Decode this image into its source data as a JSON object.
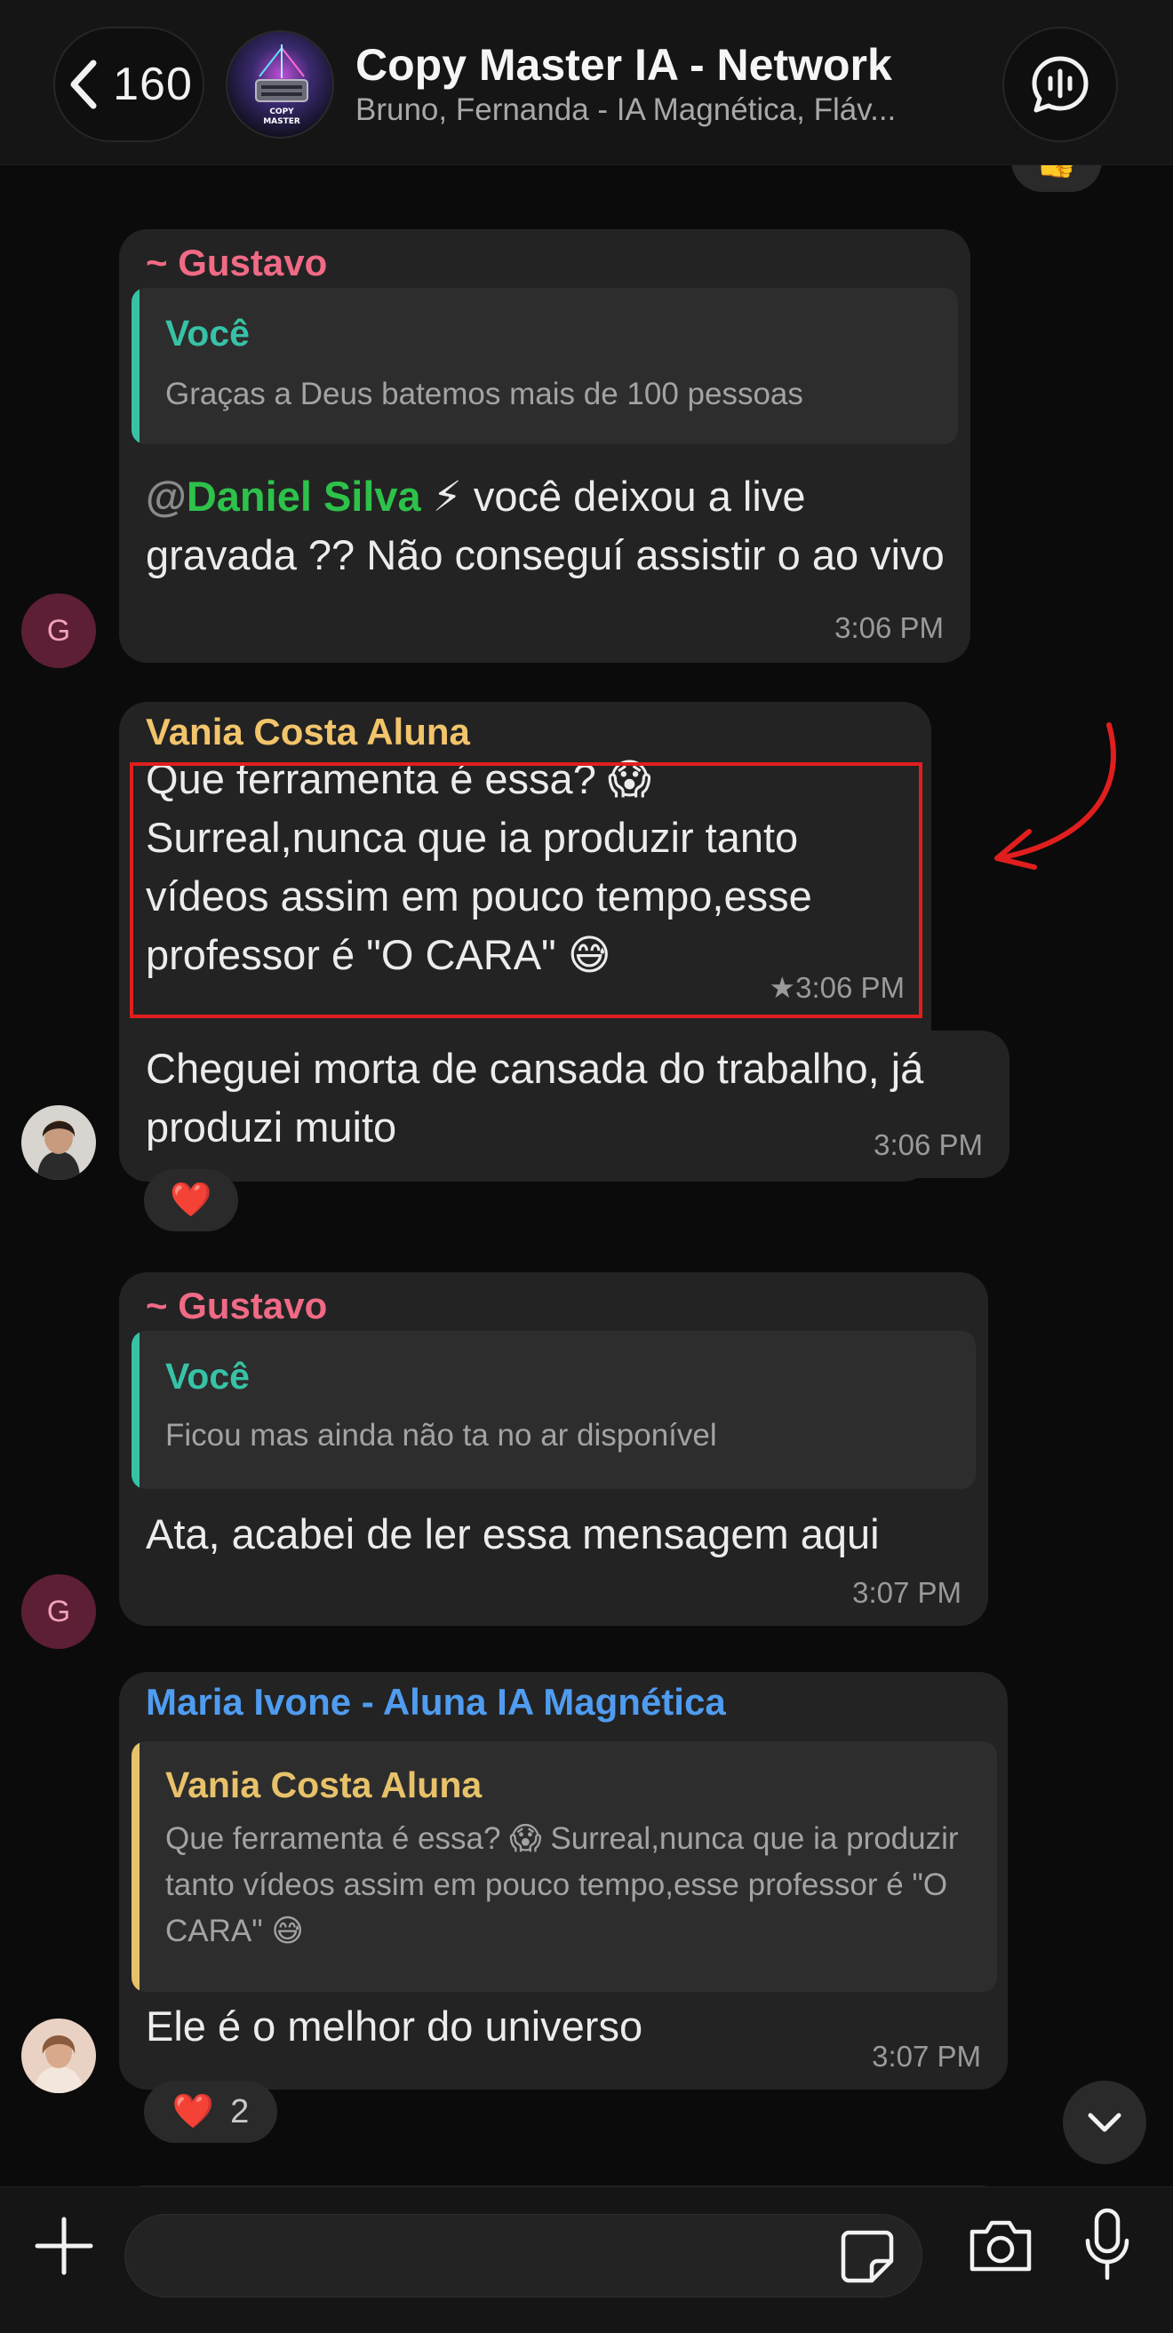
{
  "header": {
    "back_count": "160",
    "group_title": "Copy Master IA - Network",
    "group_members": "Bruno, Fernanda - IA Magnética, Fláv...",
    "group_avatar_lines": [
      "COPY",
      "MASTER"
    ]
  },
  "messages": [
    {
      "sender": "~ Gustavo",
      "sender_color": "#f06a86",
      "quote_name": "Você",
      "quote_text": "Graças a Deus batemos mais de 100 pessoas",
      "mention_at": "@",
      "mention": "Daniel Silva",
      "mention_emoji": "⚡",
      "text_after_mention": " você deixou a live gravada ?? Não conseguí assistir o ao vivo",
      "time": "3:06 PM",
      "avatar_letter": "G"
    },
    {
      "sender": "Vania Costa Aluna",
      "sender_color": "#f2c46b",
      "text": "Que ferramenta é essa? 😱 Surreal,nunca que ia produzir tanto vídeos assim em pouco tempo,esse professor é \"O CARA\" 😅",
      "star": "★",
      "time": "3:06 PM"
    },
    {
      "text": "Cheguei morta de cansada do trabalho, já produzi muito",
      "time": "3:06 PM",
      "reaction": "❤️"
    },
    {
      "sender": "~ Gustavo",
      "sender_color": "#f06a86",
      "quote_name": "Você",
      "quote_text": "Ficou mas ainda não ta no ar disponível",
      "text": "Ata, acabei de ler essa mensagem aqui",
      "time": "3:07 PM",
      "avatar_letter": "G"
    },
    {
      "sender": "Maria Ivone - Aluna IA Magnética",
      "sender_color": "#4f9cf0",
      "quote_name": "Vania Costa Aluna",
      "quote_text": "Que ferramenta é essa? 😱 Surreal,nunca que ia produzir tanto vídeos assim em pouco tempo,esse professor é \"O CARA\" 😅",
      "text": "Ele é o melhor do universo",
      "time": "3:07 PM",
      "reaction": "❤️",
      "reaction_count": "2"
    }
  ],
  "colors": {
    "you_quote": "#37c2a6",
    "vania_quote": "#e8c26a",
    "highlight": "#e01e1e",
    "arrow": "#e01e1e"
  }
}
